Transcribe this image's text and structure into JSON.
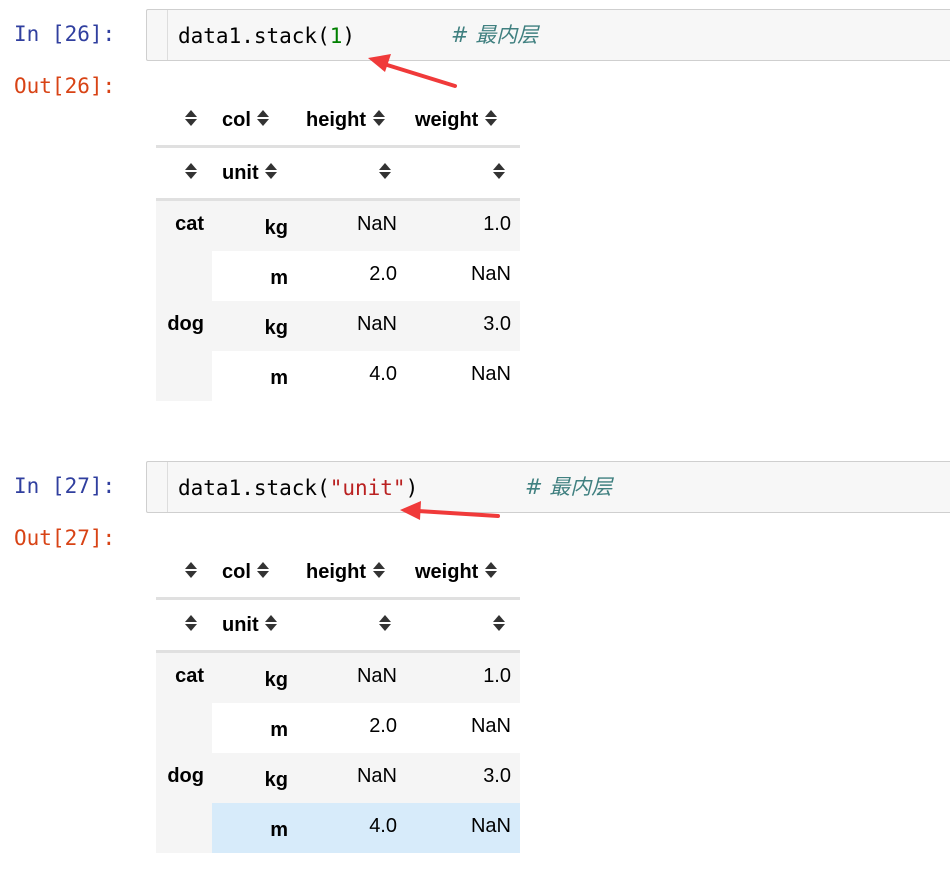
{
  "cells": [
    {
      "in_prompt": "In [26]:",
      "out_prompt": "Out[26]:",
      "code": {
        "prefix": "data1.stack(",
        "arg": "1",
        "suffix": ")",
        "comment": "# 最内层"
      },
      "table": {
        "col_header": {
          "name": "col",
          "cols": [
            "height",
            "weight"
          ]
        },
        "row_header": {
          "name": "unit"
        },
        "rows": [
          {
            "group": "cat",
            "unit": "kg",
            "height": "NaN",
            "weight": "1.0"
          },
          {
            "group": "",
            "unit": "m",
            "height": "2.0",
            "weight": "NaN"
          },
          {
            "group": "dog",
            "unit": "kg",
            "height": "NaN",
            "weight": "3.0"
          },
          {
            "group": "",
            "unit": "m",
            "height": "4.0",
            "weight": "NaN"
          }
        ]
      }
    },
    {
      "in_prompt": "In [27]:",
      "out_prompt": "Out[27]:",
      "code": {
        "prefix": "data1.stack(",
        "arg": "\"unit\"",
        "suffix": ")",
        "comment": "# 最内层"
      },
      "table": {
        "col_header": {
          "name": "col",
          "cols": [
            "height",
            "weight"
          ]
        },
        "row_header": {
          "name": "unit"
        },
        "rows": [
          {
            "group": "cat",
            "unit": "kg",
            "height": "NaN",
            "weight": "1.0"
          },
          {
            "group": "",
            "unit": "m",
            "height": "2.0",
            "weight": "NaN"
          },
          {
            "group": "dog",
            "unit": "kg",
            "height": "NaN",
            "weight": "3.0"
          },
          {
            "group": "",
            "unit": "m",
            "height": "4.0",
            "weight": "NaN"
          }
        ]
      }
    }
  ],
  "colors": {
    "in_prompt": "#303f9f",
    "out_prompt": "#d84315",
    "comment": "#408080",
    "number": "#008000",
    "string": "#ba2121",
    "annotation_arrow": "#f03a3a",
    "row_highlight": "#d7ebfa"
  },
  "icons": {
    "sort": "sort-arrows-icon",
    "annotation": "red-arrow-annotation"
  }
}
